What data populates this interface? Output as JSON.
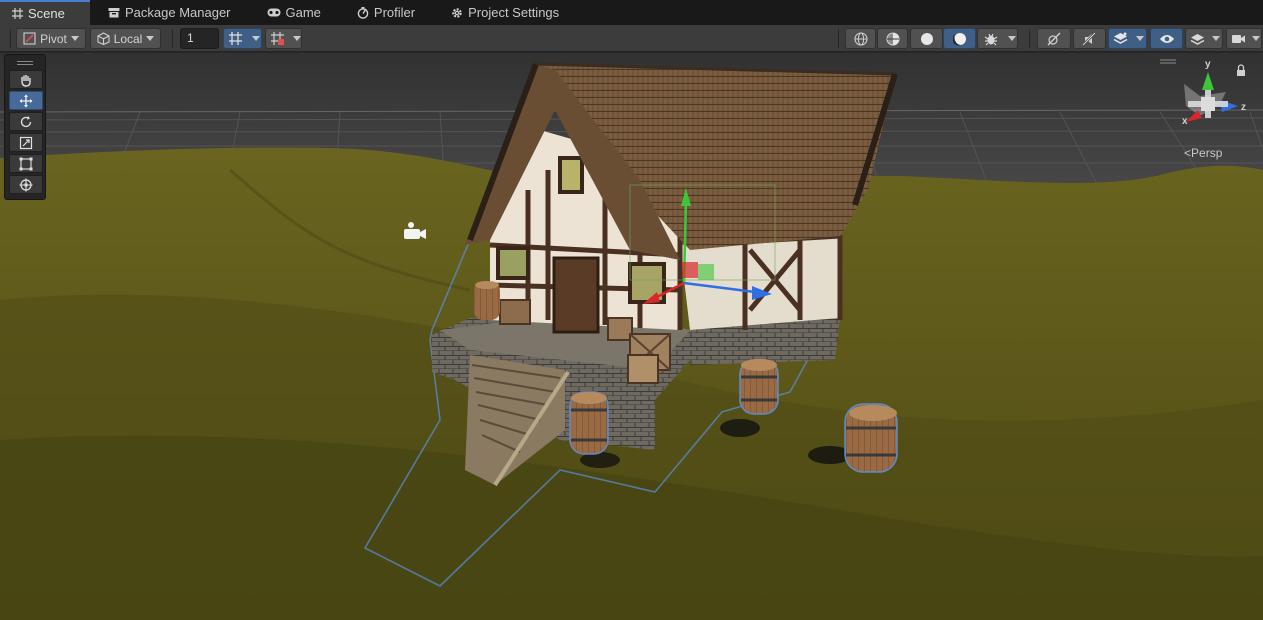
{
  "tabs": [
    {
      "label": "Scene",
      "icon": "grid-icon",
      "active": true
    },
    {
      "label": "Package Manager",
      "icon": "package-icon",
      "active": false
    },
    {
      "label": "Game",
      "icon": "gamepad-icon",
      "active": false
    },
    {
      "label": "Profiler",
      "icon": "profiler-icon",
      "active": false
    },
    {
      "label": "Project Settings",
      "icon": "gear-icon",
      "active": false
    }
  ],
  "toolbar": {
    "pivot_label": "Pivot",
    "space_label": "Local",
    "grid_snap_value": "1"
  },
  "gizmo": {
    "y_label": "y",
    "x_label": "x",
    "z_label": "z",
    "projection_label": "Persp"
  },
  "colors": {
    "accent": "#4b7fd0",
    "selected_tool": "#466a99",
    "selection_outline": "#5a8ccc",
    "axis_x": "#d8282c",
    "axis_y": "#3dc63a",
    "axis_z": "#2f6fe6"
  }
}
